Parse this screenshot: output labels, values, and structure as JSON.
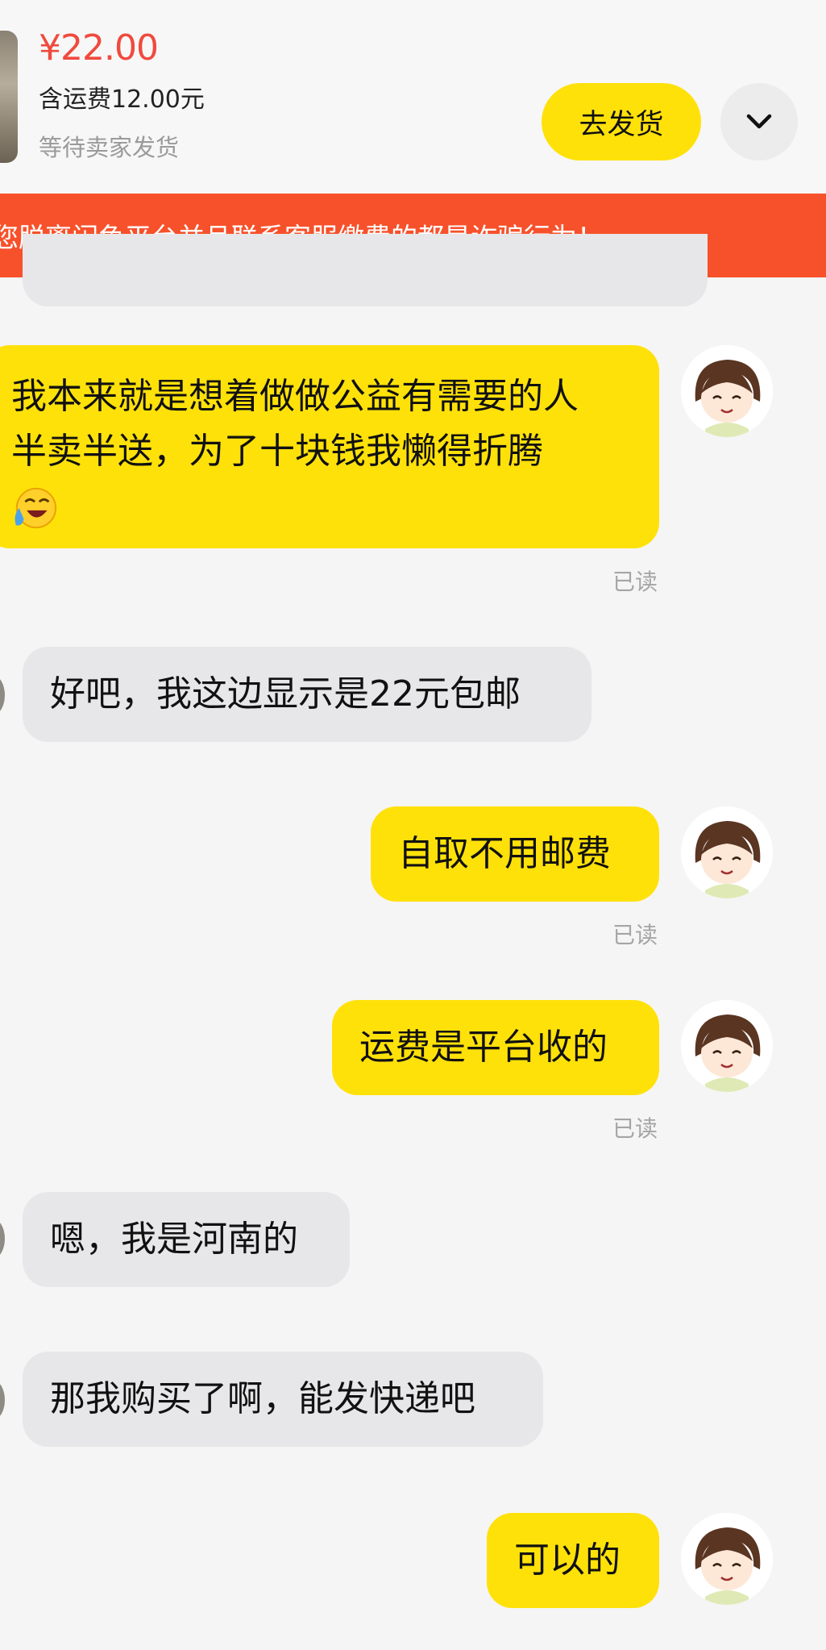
{
  "header": {
    "price": "¥22.00",
    "shipping_note": "含运费12.00元",
    "status": "等待卖家发货",
    "ship_button": "去发货",
    "more_icon": "chevron-down-icon"
  },
  "banner": {
    "warning_text": "您脱离闲鱼平台并且联系客服缴费的都是诈骗行为！"
  },
  "messages": [
    {
      "from": "me",
      "lines": [
        "我本来就是想着做做公益有需要的人",
        "半卖半送，为了十块钱我懒得折腾"
      ],
      "emoji": "crying-laughing-emoji",
      "read": "已读"
    },
    {
      "from": "them",
      "text": "好吧，我这边显示是22元包邮"
    },
    {
      "from": "me",
      "text": "自取不用邮费",
      "read": "已读"
    },
    {
      "from": "me",
      "text": "运费是平台收的",
      "read": "已读"
    },
    {
      "from": "them",
      "text": "嗯，我是河南的"
    },
    {
      "from": "them",
      "text": "那我购买了啊，能发快递吧"
    },
    {
      "from": "me",
      "text": "可以的"
    }
  ],
  "colors": {
    "accent_yellow": "#ffe10a",
    "banner_red": "#f7512b",
    "price_red": "#f04a3e",
    "peer_bubble": "#e7e7e9"
  }
}
